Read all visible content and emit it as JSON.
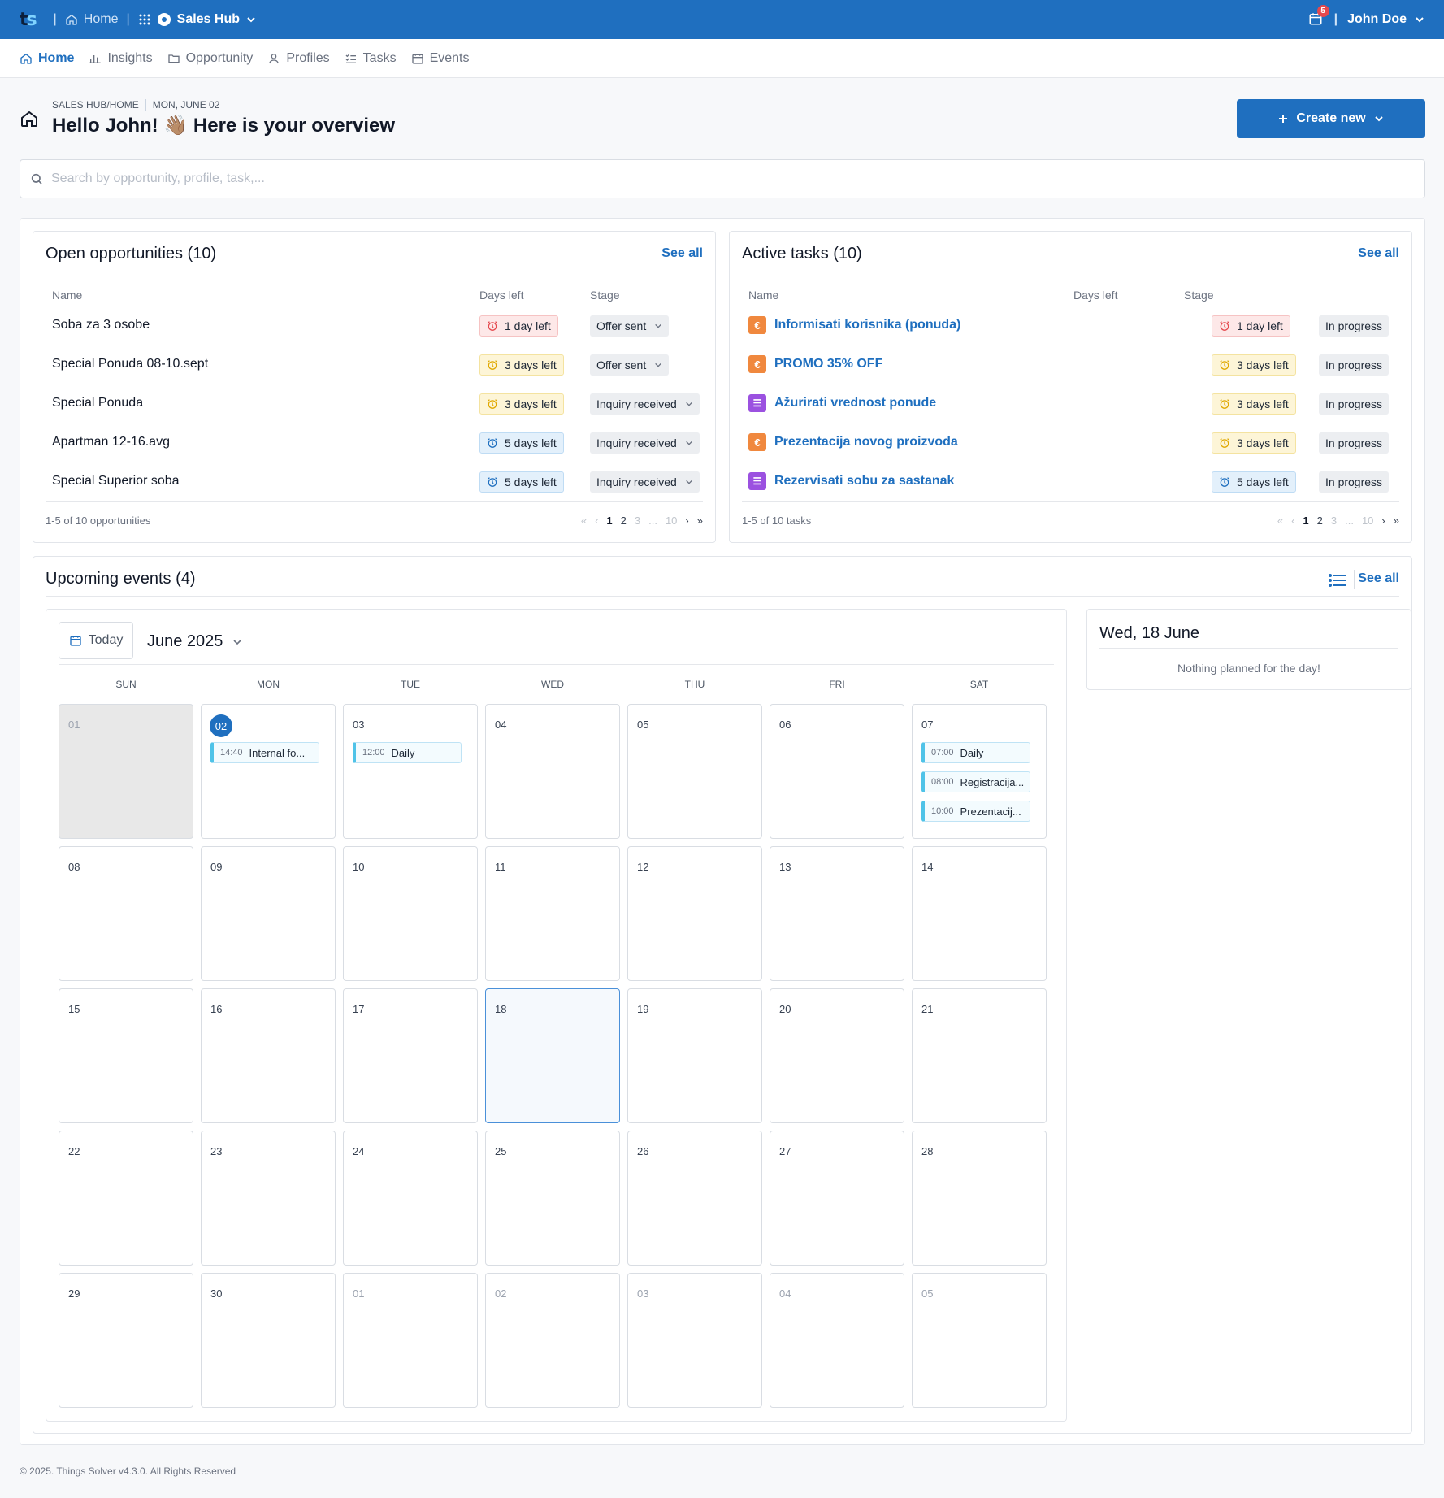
{
  "topbar": {
    "logo": "ts",
    "home_label": "Home",
    "hub_label": "Sales Hub",
    "notifications_count": "5",
    "user_name": "John Doe"
  },
  "nav": {
    "tabs": [
      {
        "label": "Home",
        "active": true
      },
      {
        "label": "Insights"
      },
      {
        "label": "Opportunity"
      },
      {
        "label": "Profiles"
      },
      {
        "label": "Tasks"
      },
      {
        "label": "Events"
      }
    ]
  },
  "header": {
    "breadcrumb": "SALES HUB/HOME",
    "date": "MON, JUNE 02",
    "title": "Hello John! 👋🏽 Here is your overview",
    "create_label": "Create new"
  },
  "search": {
    "placeholder": "Search by opportunity, profile, task,..."
  },
  "opportunities": {
    "title": "Open opportunities (10)",
    "see_all": "See all",
    "columns": [
      "Name",
      "Days left",
      "Stage"
    ],
    "rows": [
      {
        "name": "Soba za 3 osobe",
        "days": "1 day left",
        "urgency": "red",
        "stage": "Offer sent"
      },
      {
        "name": "Special Ponuda 08-10.sept",
        "days": "3 days left",
        "urgency": "yellow",
        "stage": "Offer sent"
      },
      {
        "name": "Special Ponuda",
        "days": "3 days left",
        "urgency": "yellow",
        "stage": "Inquiry received"
      },
      {
        "name": "Apartman 12-16.avg",
        "days": "5 days left",
        "urgency": "blue",
        "stage": "Inquiry received"
      },
      {
        "name": "Special Superior soba",
        "days": "5 days left",
        "urgency": "blue",
        "stage": "Inquiry received"
      }
    ],
    "footer": "1-5 of 10 opportunities",
    "pages": [
      "1",
      "2",
      "3",
      "...",
      "10"
    ]
  },
  "tasks": {
    "title": "Active tasks (10)",
    "see_all": "See all",
    "columns": [
      "Name",
      "Days left",
      "Stage"
    ],
    "rows": [
      {
        "name": "Informisati korisnika (ponuda)",
        "icon": "euro-icon",
        "days": "1 day left",
        "urgency": "red",
        "stage": "In progress"
      },
      {
        "name": "PROMO 35% OFF",
        "icon": "euro-icon",
        "days": "3 days left",
        "urgency": "yellow",
        "stage": "In progress"
      },
      {
        "name": "Ažurirati vrednost ponude",
        "icon": "checklist-icon",
        "days": "3 days left",
        "urgency": "yellow",
        "stage": "In progress"
      },
      {
        "name": "Prezentacija novog proizvoda",
        "icon": "euro-icon",
        "days": "3 days left",
        "urgency": "yellow",
        "stage": "In progress"
      },
      {
        "name": "Rezervisati sobu za sastanak",
        "icon": "checklist-icon",
        "days": "5 days left",
        "urgency": "blue",
        "stage": "In progress"
      }
    ],
    "footer": "1-5 of 10 tasks",
    "pages": [
      "1",
      "2",
      "3",
      "...",
      "10"
    ]
  },
  "events": {
    "title": "Upcoming events (4)",
    "see_all": "See all",
    "today_label": "Today",
    "month_label": "June 2025",
    "weekdays": [
      "SUN",
      "MON",
      "TUE",
      "WED",
      "THU",
      "FRI",
      "SAT"
    ],
    "days": [
      {
        "n": "01",
        "state": "gray"
      },
      {
        "n": "02",
        "state": "current"
      },
      {
        "n": "03"
      },
      {
        "n": "04"
      },
      {
        "n": "05"
      },
      {
        "n": "06"
      },
      {
        "n": "07"
      },
      {
        "n": "08"
      },
      {
        "n": "09"
      },
      {
        "n": "10"
      },
      {
        "n": "11"
      },
      {
        "n": "12"
      },
      {
        "n": "13"
      },
      {
        "n": "14"
      },
      {
        "n": "15"
      },
      {
        "n": "16"
      },
      {
        "n": "17"
      },
      {
        "n": "18",
        "state": "selected"
      },
      {
        "n": "19"
      },
      {
        "n": "20"
      },
      {
        "n": "21"
      },
      {
        "n": "22"
      },
      {
        "n": "23"
      },
      {
        "n": "24"
      },
      {
        "n": "25"
      },
      {
        "n": "26"
      },
      {
        "n": "27"
      },
      {
        "n": "28"
      },
      {
        "n": "29"
      },
      {
        "n": "30"
      },
      {
        "n": "01",
        "state": "muted"
      },
      {
        "n": "02",
        "state": "muted"
      },
      {
        "n": "03",
        "state": "muted"
      },
      {
        "n": "04",
        "state": "muted"
      },
      {
        "n": "05",
        "state": "muted"
      }
    ],
    "items": {
      "1": [
        {
          "time": "14:40",
          "title": "Internal fo..."
        }
      ],
      "2": [
        {
          "time": "12:00",
          "title": "Daily"
        }
      ],
      "6": [
        {
          "time": "07:00",
          "title": "Daily"
        },
        {
          "time": "08:00",
          "title": "Registracija..."
        },
        {
          "time": "10:00",
          "title": "Prezentacij..."
        }
      ]
    },
    "side_title": "Wed, 18 June",
    "side_empty": "Nothing planned for the day!"
  },
  "footer": "© 2025. Things Solver v4.3.0. All Rights Reserved"
}
